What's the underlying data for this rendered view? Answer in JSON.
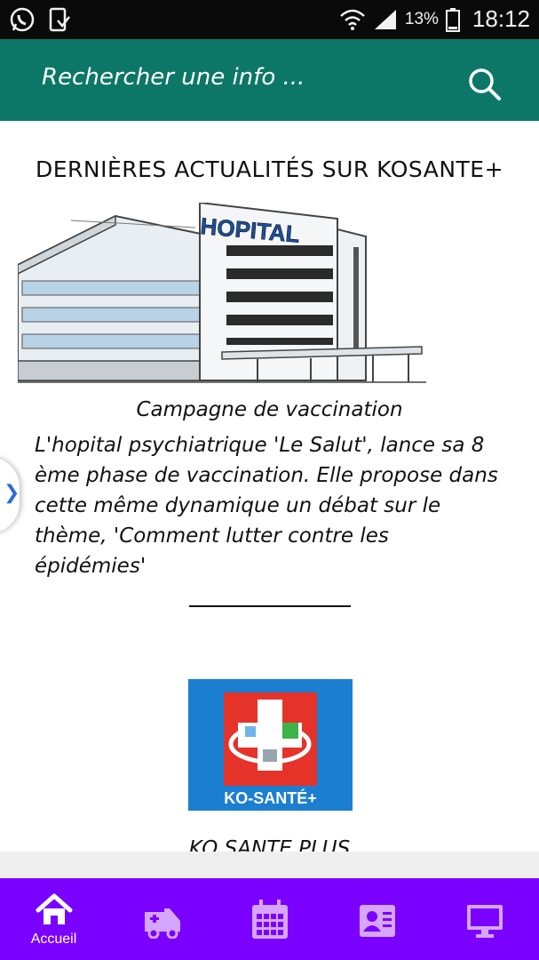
{
  "status_bar": {
    "battery_percent": "13%",
    "time": "18:12"
  },
  "app_bar": {
    "search_placeholder": "Rechercher une info ..."
  },
  "main": {
    "section_title": "DERNIÈRES ACTUALITÉS SUR KOSANTE+",
    "hospital_sign": "HOPITAL",
    "article": {
      "title": "Campagne de vaccination",
      "body": "L'hopital psychiatrique 'Le Salut', lance sa 8 ème phase de vaccination. Elle propose dans cette même dynamique un débat sur le thème, 'Comment lutter contre les épidémies'"
    },
    "logo_caption": "KO-SANTÉ+",
    "next_title_partial": "KO SANTE PLUS"
  },
  "bottom_nav": {
    "items": [
      {
        "label": "Accueil",
        "icon": "home-icon",
        "active": true
      },
      {
        "label": "",
        "icon": "ambulance-icon",
        "active": false
      },
      {
        "label": "",
        "icon": "calendar-icon",
        "active": false
      },
      {
        "label": "",
        "icon": "contacts-icon",
        "active": false
      },
      {
        "label": "",
        "icon": "monitor-icon",
        "active": false
      }
    ]
  },
  "colors": {
    "app_bar": "#0c7766",
    "bottom_nav": "#7a00ff",
    "nav_icon_inactive": "#d6a5ff",
    "logo_blue": "#1b7fd1",
    "logo_red": "#e5332a"
  }
}
